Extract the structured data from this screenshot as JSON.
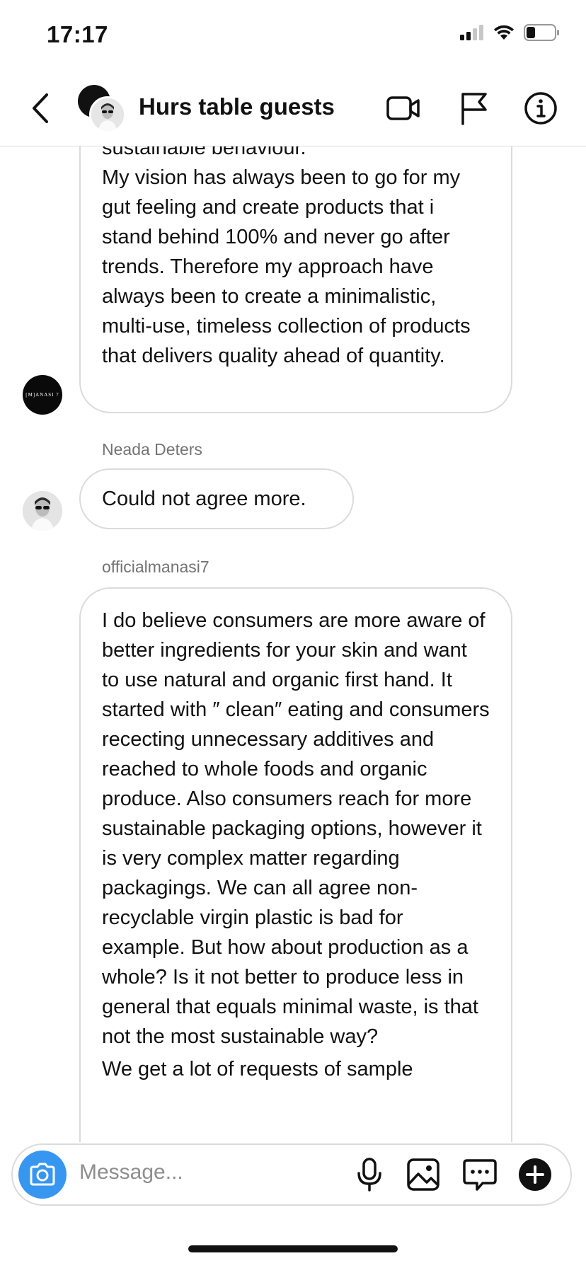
{
  "status_bar": {
    "time": "17:17"
  },
  "header": {
    "title": "Hurs table guests"
  },
  "messages": {
    "m1": {
      "partial": "sustainable behaviour.",
      "text": "My vision has always been to go for my gut feeling and create products that i stand behind 100% and never go after trends. Therefore my approach have always been to create a minimalistic, multi-use, timeless collection of products that delivers quality ahead of quantity."
    },
    "m2": {
      "sender": "Neada Deters",
      "text": "Could not agree more."
    },
    "m3": {
      "sender": "officialmanasi7",
      "text": "I do believe consumers are more aware of better ingredients for your skin and want to use natural and organic first hand. It started with ″ clean″ eating and consumers rececting unnecessary additives and reached to whole foods and organic produce. Also consumers reach for more sustainable packaging options, however it is very complex matter regarding packagings. We can all agree non-recyclable virgin plastic is bad for example. But how about production as a whole? Is it not better to produce less in general that equals minimal waste, is that not the most sustainable way?",
      "text2": "We get a lot of requests of sample"
    },
    "brand_logo_text": "[M]ANASI 7"
  },
  "composer": {
    "placeholder": "Message..."
  },
  "colors": {
    "accent": "#3797f0",
    "border": "#dbdbdb",
    "muted": "#737373"
  }
}
